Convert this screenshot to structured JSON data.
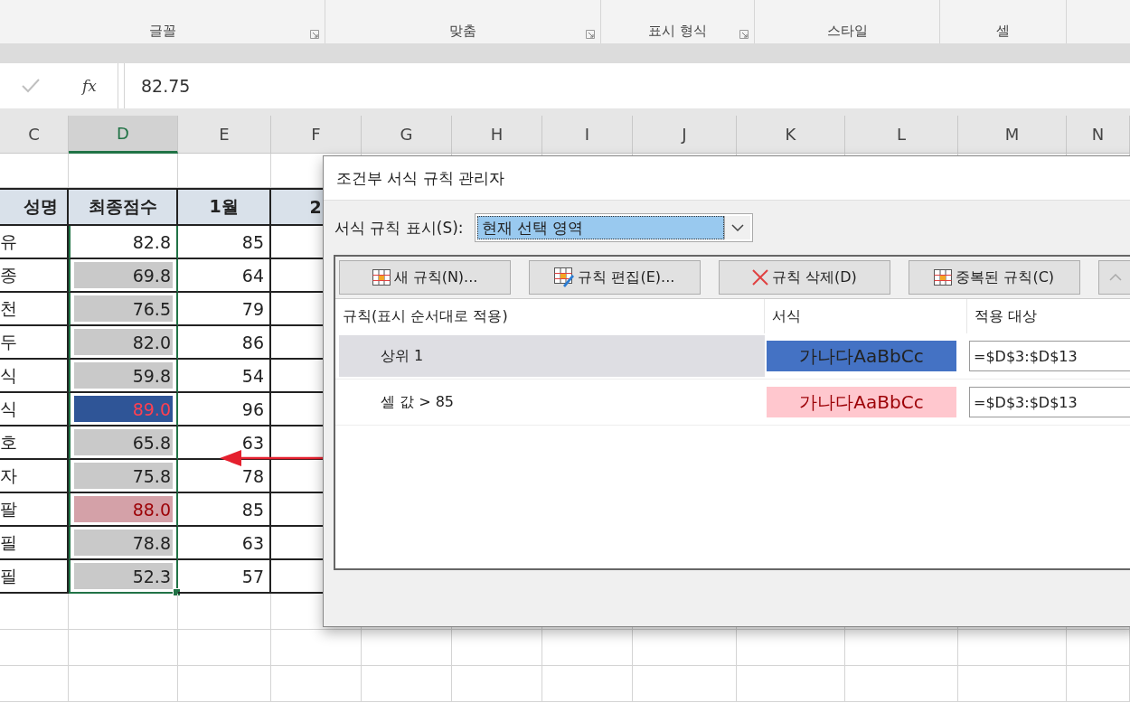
{
  "ribbon": {
    "groups": [
      {
        "label": "글꼴",
        "launcher": true
      },
      {
        "label": "맞춤",
        "launcher": true
      },
      {
        "label": "표시 형식",
        "launcher": true
      },
      {
        "label": "스타일",
        "launcher": false
      },
      {
        "label": "셀",
        "launcher": false
      }
    ]
  },
  "formula_bar": {
    "enter_disabled": true,
    "function_label": "fx",
    "value": "82.75"
  },
  "sheet": {
    "columns": [
      {
        "label": "C",
        "selected": false
      },
      {
        "label": "D",
        "selected": true
      },
      {
        "label": "E",
        "selected": false
      },
      {
        "label": "F",
        "selected": false
      },
      {
        "label": "G",
        "selected": false
      },
      {
        "label": "H",
        "selected": false
      },
      {
        "label": "I",
        "selected": false
      },
      {
        "label": "J",
        "selected": false
      },
      {
        "label": "K",
        "selected": false
      },
      {
        "label": "L",
        "selected": false
      },
      {
        "label": "M",
        "selected": false
      },
      {
        "label": "N",
        "selected": false
      }
    ],
    "header_row": [
      "성명",
      "최종점수",
      "1월",
      "2"
    ],
    "rows": [
      {
        "name": "유",
        "score": "82.8",
        "kind": "plain",
        "month_1": "85"
      },
      {
        "name": "종",
        "score": "69.8",
        "kind": "gray",
        "month_1": "64"
      },
      {
        "name": "천",
        "score": "76.5",
        "kind": "gray",
        "month_1": "79"
      },
      {
        "name": "두",
        "score": "82.0",
        "kind": "gray",
        "month_1": "86"
      },
      {
        "name": "식",
        "score": "59.8",
        "kind": "gray",
        "month_1": "54"
      },
      {
        "name": "식",
        "score": "89.0",
        "kind": "top",
        "month_1": "96"
      },
      {
        "name": "호",
        "score": "65.8",
        "kind": "gray",
        "month_1": "63"
      },
      {
        "name": "자",
        "score": "75.8",
        "kind": "gray",
        "month_1": "78"
      },
      {
        "name": "팔",
        "score": "88.0",
        "kind": "above",
        "month_1": "85"
      },
      {
        "name": "필",
        "score": "78.8",
        "kind": "gray",
        "month_1": "63"
      },
      {
        "name": "필",
        "score": "52.3",
        "kind": "gray",
        "month_1": "57"
      }
    ]
  },
  "dialog": {
    "title": "조건부 서식 규칙 관리자",
    "show_label": "서식 규칙 표시(S):",
    "show_value": "현재 선택 영역",
    "buttons": [
      {
        "kind": "new",
        "label": "새 규칙(N)..."
      },
      {
        "kind": "edit",
        "label": "규칙 편집(E)..."
      },
      {
        "kind": "delete",
        "label": "규칙 삭제(D)"
      },
      {
        "kind": "duplicate",
        "label": "중복된 규칙(C)"
      },
      {
        "kind": "up"
      }
    ],
    "columns": [
      "규칙(표시 순서대로 적용)",
      "서식",
      "적용 대상"
    ],
    "rules": [
      {
        "name": "상위 1",
        "preview": "가나다AaBbCc",
        "kind": "top",
        "applies_to": "=$D$3:$D$13",
        "selected": true
      },
      {
        "name": "셀 값 > 85",
        "preview": "가나다AaBbCc",
        "kind": "above",
        "applies_to": "=$D$3:$D$13",
        "selected": false
      }
    ]
  }
}
